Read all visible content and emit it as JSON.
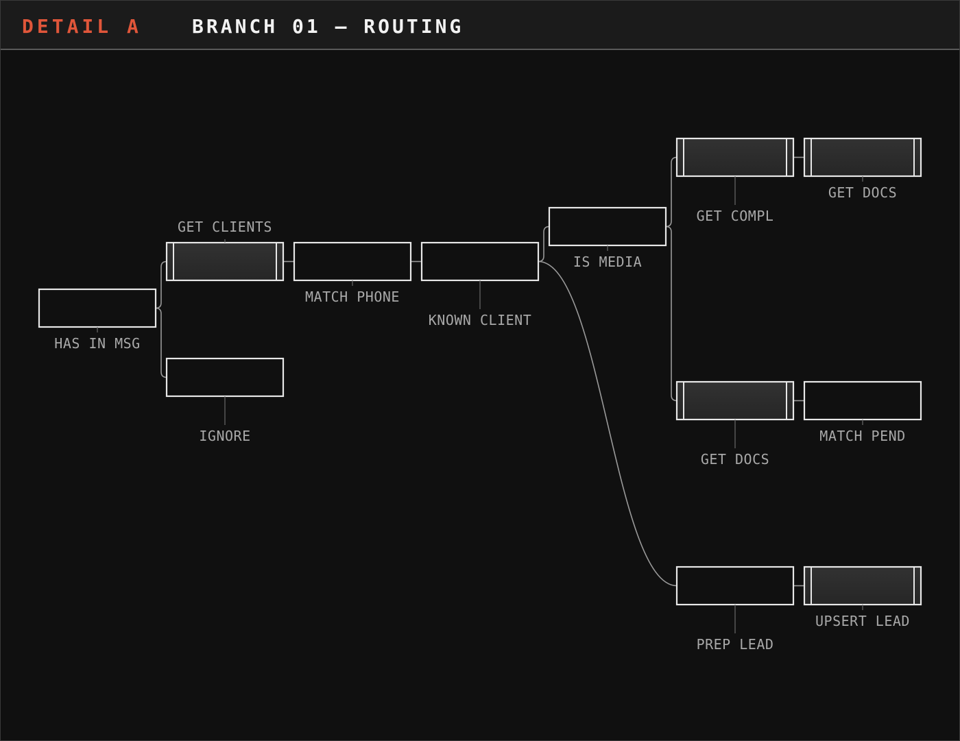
{
  "header": {
    "detail_label": "DETAIL A",
    "title": "BRANCH 01 — ROUTING",
    "accent_color": "#e0563a"
  },
  "nodes": [
    {
      "id": "has_in_msg",
      "label": "HAS IN MSG",
      "style": "plain"
    },
    {
      "id": "get_clients",
      "label": "GET CLIENTS",
      "style": "filled"
    },
    {
      "id": "ignore",
      "label": "IGNORE",
      "style": "plain"
    },
    {
      "id": "match_phone",
      "label": "MATCH PHONE",
      "style": "plain"
    },
    {
      "id": "known_client",
      "label": "KNOWN CLIENT",
      "style": "plain"
    },
    {
      "id": "is_media",
      "label": "IS MEDIA",
      "style": "plain"
    },
    {
      "id": "get_compl",
      "label": "GET COMPL",
      "style": "filled"
    },
    {
      "id": "get_docs_top",
      "label": "GET DOCS",
      "style": "filled"
    },
    {
      "id": "get_docs_mid",
      "label": "GET DOCS",
      "style": "filled"
    },
    {
      "id": "match_pend",
      "label": "MATCH PEND",
      "style": "plain"
    },
    {
      "id": "prep_lead",
      "label": "PREP LEAD",
      "style": "plain"
    },
    {
      "id": "upsert_lead",
      "label": "UPSERT LEAD",
      "style": "filled"
    }
  ],
  "edges": [
    [
      "has_in_msg",
      "get_clients"
    ],
    [
      "has_in_msg",
      "ignore"
    ],
    [
      "get_clients",
      "match_phone"
    ],
    [
      "match_phone",
      "known_client"
    ],
    [
      "known_client",
      "is_media"
    ],
    [
      "known_client",
      "prep_lead"
    ],
    [
      "is_media",
      "get_compl"
    ],
    [
      "is_media",
      "get_docs_mid"
    ],
    [
      "get_compl",
      "get_docs_top"
    ],
    [
      "get_docs_mid",
      "match_pend"
    ],
    [
      "prep_lead",
      "upsert_lead"
    ]
  ]
}
